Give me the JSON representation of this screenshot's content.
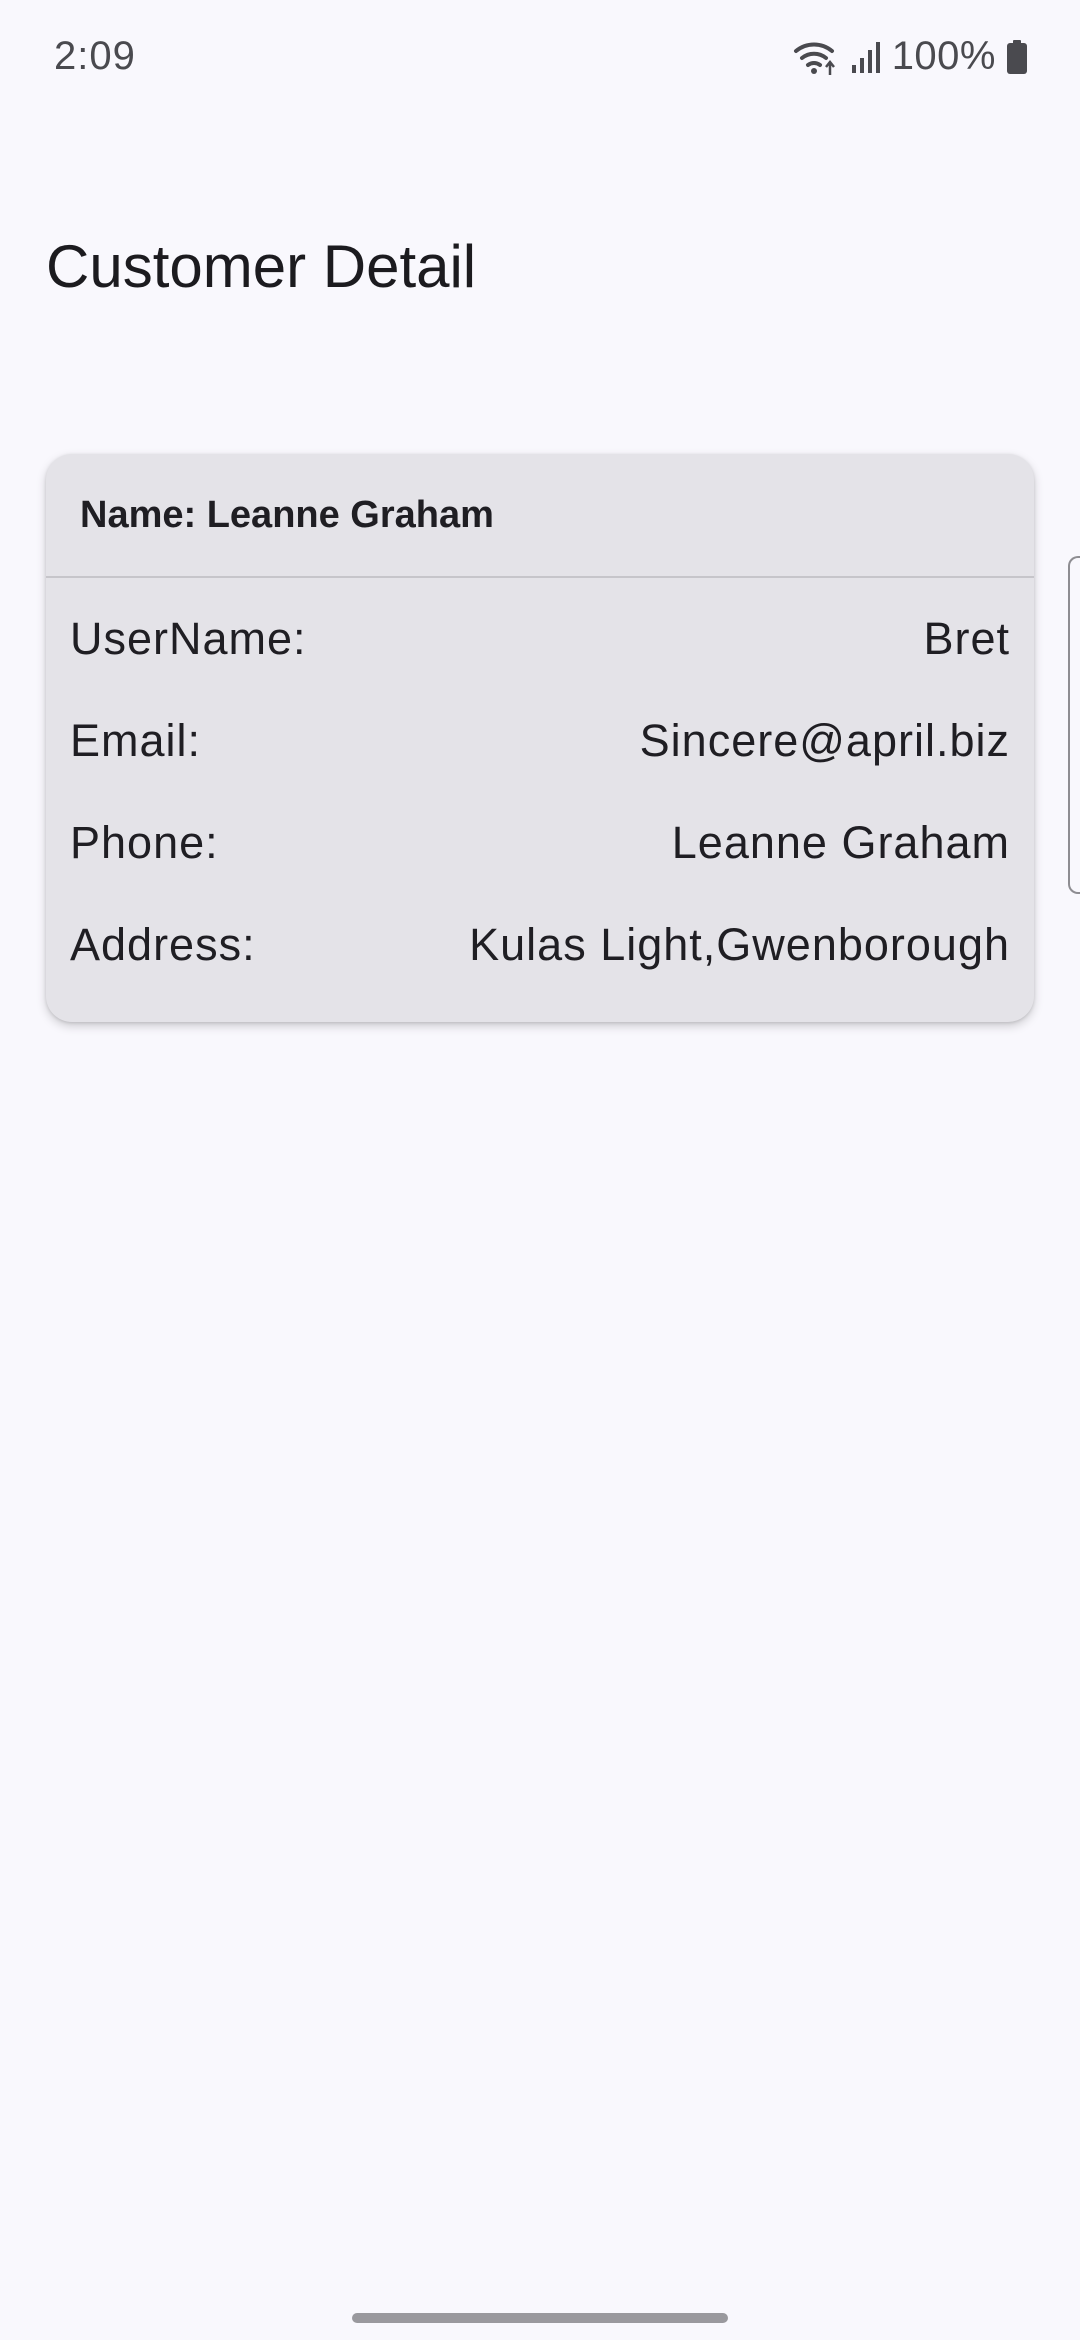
{
  "status_bar": {
    "time": "2:09",
    "battery": "100%"
  },
  "page": {
    "title": "Customer Detail"
  },
  "customer": {
    "header": "Name: Leanne Graham",
    "rows": [
      {
        "label": "UserName:",
        "value": "Bret"
      },
      {
        "label": "Email:",
        "value": "Sincere@april.biz"
      },
      {
        "label": "Phone:",
        "value": "Leanne Graham"
      },
      {
        "label": "Address:",
        "value": "Kulas Light,Gwenborough"
      }
    ]
  },
  "icons": [
    "wifi-icon",
    "signal-icon",
    "battery-icon"
  ],
  "colors": {
    "background": "#f9f8fd",
    "card": "#e4e3e8",
    "text": "#1c1b1f",
    "divider": "#c6c5ca"
  }
}
